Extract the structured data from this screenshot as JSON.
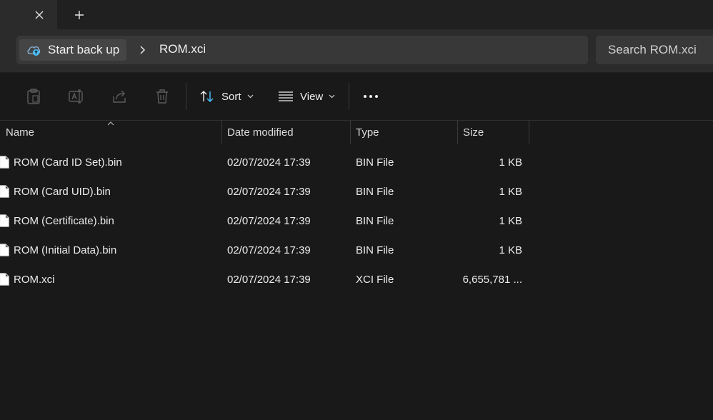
{
  "tabs": {
    "close_icon": "close-icon",
    "new_tab_icon": "plus-icon"
  },
  "address": {
    "backup_label": "Start back up",
    "crumb": "ROM.xci",
    "search_placeholder": "Search ROM.xci"
  },
  "toolbar": {
    "sort_label": "Sort",
    "view_label": "View"
  },
  "columns": {
    "name": "Name",
    "date": "Date modified",
    "type": "Type",
    "size": "Size"
  },
  "files": [
    {
      "name": "ROM (Card ID Set).bin",
      "date": "02/07/2024 17:39",
      "type": "BIN File",
      "size": "1 KB"
    },
    {
      "name": "ROM (Card UID).bin",
      "date": "02/07/2024 17:39",
      "type": "BIN File",
      "size": "1 KB"
    },
    {
      "name": "ROM (Certificate).bin",
      "date": "02/07/2024 17:39",
      "type": "BIN File",
      "size": "1 KB"
    },
    {
      "name": "ROM (Initial Data).bin",
      "date": "02/07/2024 17:39",
      "type": "BIN File",
      "size": "1 KB"
    },
    {
      "name": "ROM.xci",
      "date": "02/07/2024 17:39",
      "type": "XCI File",
      "size": "6,655,781 ..."
    }
  ],
  "colors": {
    "background": "#191919",
    "accent_blue": "#4cc2ff"
  }
}
